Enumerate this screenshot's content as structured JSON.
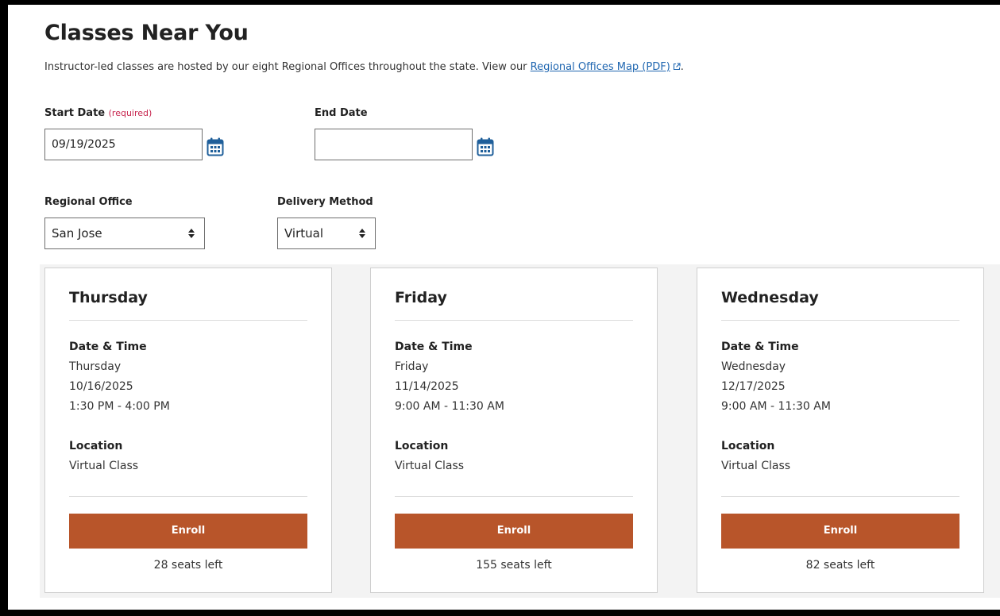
{
  "header": {
    "title": "Classes Near You",
    "intro_text": "Instructor-led classes are hosted by our eight Regional Offices throughout the state. View our ",
    "intro_link": "Regional Offices Map (PDF)",
    "intro_end": "."
  },
  "filters": {
    "start_date": {
      "label": "Start Date",
      "required_text": "(required)",
      "value": "09/19/2025"
    },
    "end_date": {
      "label": "End Date",
      "value": ""
    },
    "regional_office": {
      "label": "Regional Office",
      "selected": "San Jose"
    },
    "delivery_method": {
      "label": "Delivery Method",
      "selected": "Virtual"
    }
  },
  "cards": [
    {
      "day": "Thursday",
      "datetime_label": "Date & Time",
      "weekday": "Thursday",
      "date": "10/16/2025",
      "time": "1:30 PM - 4:00 PM",
      "location_label": "Location",
      "location": "Virtual Class",
      "enroll_label": "Enroll",
      "seats": "28 seats left"
    },
    {
      "day": "Friday",
      "datetime_label": "Date & Time",
      "weekday": "Friday",
      "date": "11/14/2025",
      "time": "9:00 AM - 11:30 AM",
      "location_label": "Location",
      "location": "Virtual Class",
      "enroll_label": "Enroll",
      "seats": "155 seats left"
    },
    {
      "day": "Wednesday",
      "datetime_label": "Date & Time",
      "weekday": "Wednesday",
      "date": "12/17/2025",
      "time": "9:00 AM - 11:30 AM",
      "location_label": "Location",
      "location": "Virtual Class",
      "enroll_label": "Enroll",
      "seats": "82 seats left"
    }
  ],
  "icons": {
    "calendar": "calendar-icon",
    "external_link": "external-link-icon",
    "select_arrows": "sort-arrows-icon"
  },
  "colors": {
    "enroll_button": "#b8552a",
    "link": "#1f66b0",
    "required": "#c7254e",
    "calendar_icon": "#1f5f9a"
  }
}
